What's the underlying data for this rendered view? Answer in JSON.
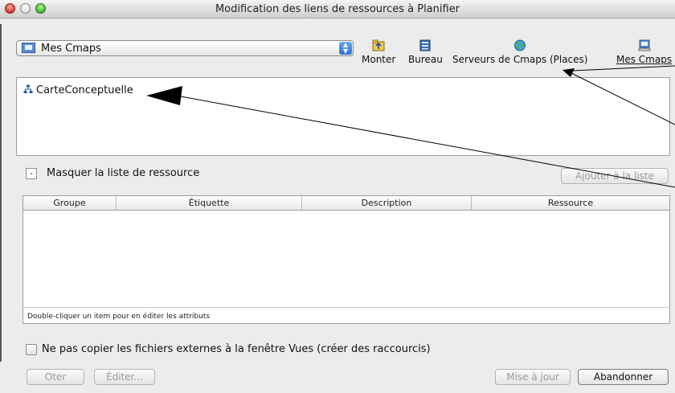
{
  "window": {
    "title": "Modification des liens de ressources à Planifier"
  },
  "location": {
    "selected": "Mes Cmaps",
    "icon": "computer-icon"
  },
  "toolbar": {
    "up_label": "Monter",
    "desktop_label": "Bureau",
    "servers_label": "Serveurs de Cmaps (Places)",
    "mycmaps_label": "Mes Cmaps"
  },
  "tree": {
    "item_label": "CarteConceptuelle",
    "item_icon": "concept-map-icon"
  },
  "resource_list": {
    "toggle_symbol": "-",
    "toggle_label": "Masquer la liste de ressource",
    "add_button": "Ajouter à la liste",
    "columns": [
      "Groupe",
      "Étiquette",
      "Description",
      "Ressource"
    ],
    "rows": [],
    "hint": "Double-cliquer un item pour en éditer les attributs"
  },
  "options": {
    "no_copy_label": "Ne pas copier les fichiers externes à la fenêtre Vues (créer des raccourcis)",
    "no_copy_checked": false
  },
  "buttons": {
    "remove": "Oter",
    "edit": "Éditer...",
    "update": "Mise à jour",
    "cancel": "Abandonner"
  },
  "colors": {
    "window_bg": "#ececec",
    "accent": "#2b6fd2",
    "close": "#e0443b",
    "zoom": "#4fbf3a"
  }
}
